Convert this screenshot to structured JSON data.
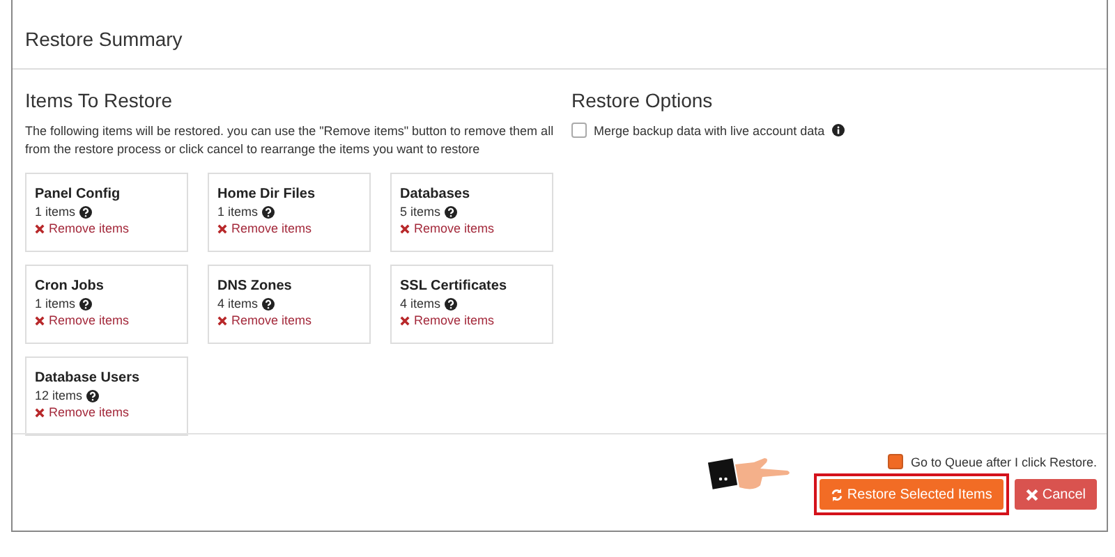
{
  "panel": {
    "title": "Restore Summary"
  },
  "items_section": {
    "heading": "Items To Restore",
    "description": "The following items will be restored. you can use the \"Remove items\" button to remove them all from the restore process or click cancel to rearrange the items you want to restore",
    "items": [
      {
        "name": "Panel Config",
        "count": "1 items",
        "remove": "Remove items"
      },
      {
        "name": "Home Dir Files",
        "count": "1 items",
        "remove": "Remove items"
      },
      {
        "name": "Databases",
        "count": "5 items",
        "remove": "Remove items"
      },
      {
        "name": "Cron Jobs",
        "count": "1 items",
        "remove": "Remove items"
      },
      {
        "name": "DNS Zones",
        "count": "4 items",
        "remove": "Remove items"
      },
      {
        "name": "SSL Certificates",
        "count": "4 items",
        "remove": "Remove items"
      },
      {
        "name": "Database Users",
        "count": "12 items",
        "remove": "Remove items"
      }
    ]
  },
  "options": {
    "heading": "Restore Options",
    "merge": {
      "label": "Merge backup data with live account data",
      "checked": false
    }
  },
  "footer": {
    "queue": {
      "label": "Go to Queue after I click Restore.",
      "checked": true
    },
    "restore_button": {
      "label": "Restore Selected Items",
      "highlighted": true
    },
    "cancel_button": {
      "label": "Cancel"
    }
  }
}
